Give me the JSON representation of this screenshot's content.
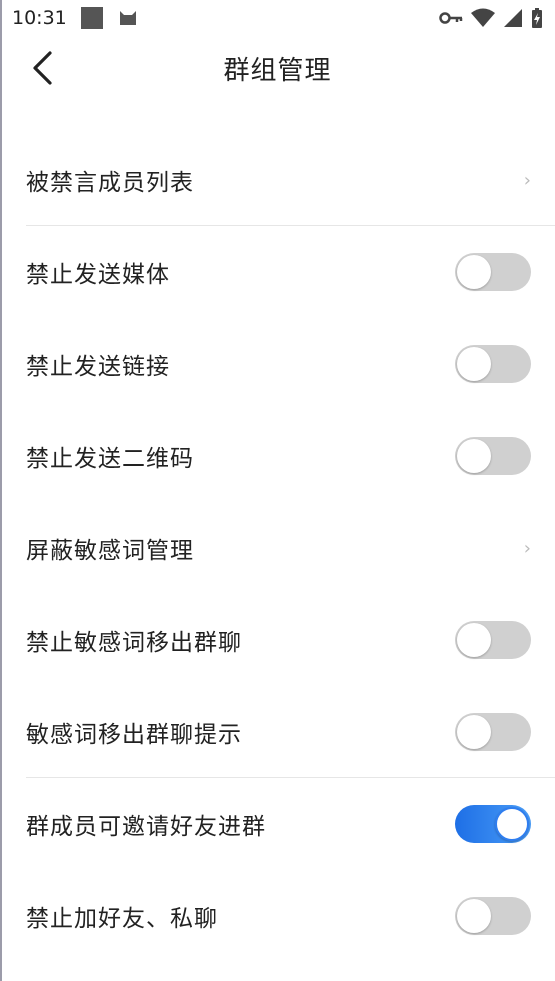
{
  "status_bar": {
    "time": "10:31",
    "icons": [
      "square-notification-icon",
      "cat-notification-icon",
      "key-icon",
      "wifi-icon",
      "signal-icon",
      "battery-charging-icon"
    ]
  },
  "header": {
    "title": "群组管理",
    "back_icon": "chevron-left-icon"
  },
  "items": [
    {
      "label": "被禁言成员列表",
      "type": "link"
    },
    {
      "label": "禁止发送媒体",
      "type": "toggle",
      "on": false
    },
    {
      "label": "禁止发送链接",
      "type": "toggle",
      "on": false
    },
    {
      "label": "禁止发送二维码",
      "type": "toggle",
      "on": false
    },
    {
      "label": "屏蔽敏感词管理",
      "type": "link"
    },
    {
      "label": "禁止敏感词移出群聊",
      "type": "toggle",
      "on": false
    },
    {
      "label": "敏感词移出群聊提示",
      "type": "toggle",
      "on": false
    },
    {
      "label": "群成员可邀请好友进群",
      "type": "toggle",
      "on": true
    },
    {
      "label": "禁止加好友、私聊",
      "type": "toggle",
      "on": false
    }
  ],
  "colors": {
    "toggle_on": "#2f7ef0",
    "toggle_off": "#d0d0d0",
    "text": "#222222",
    "divider": "#e6e6e6"
  }
}
